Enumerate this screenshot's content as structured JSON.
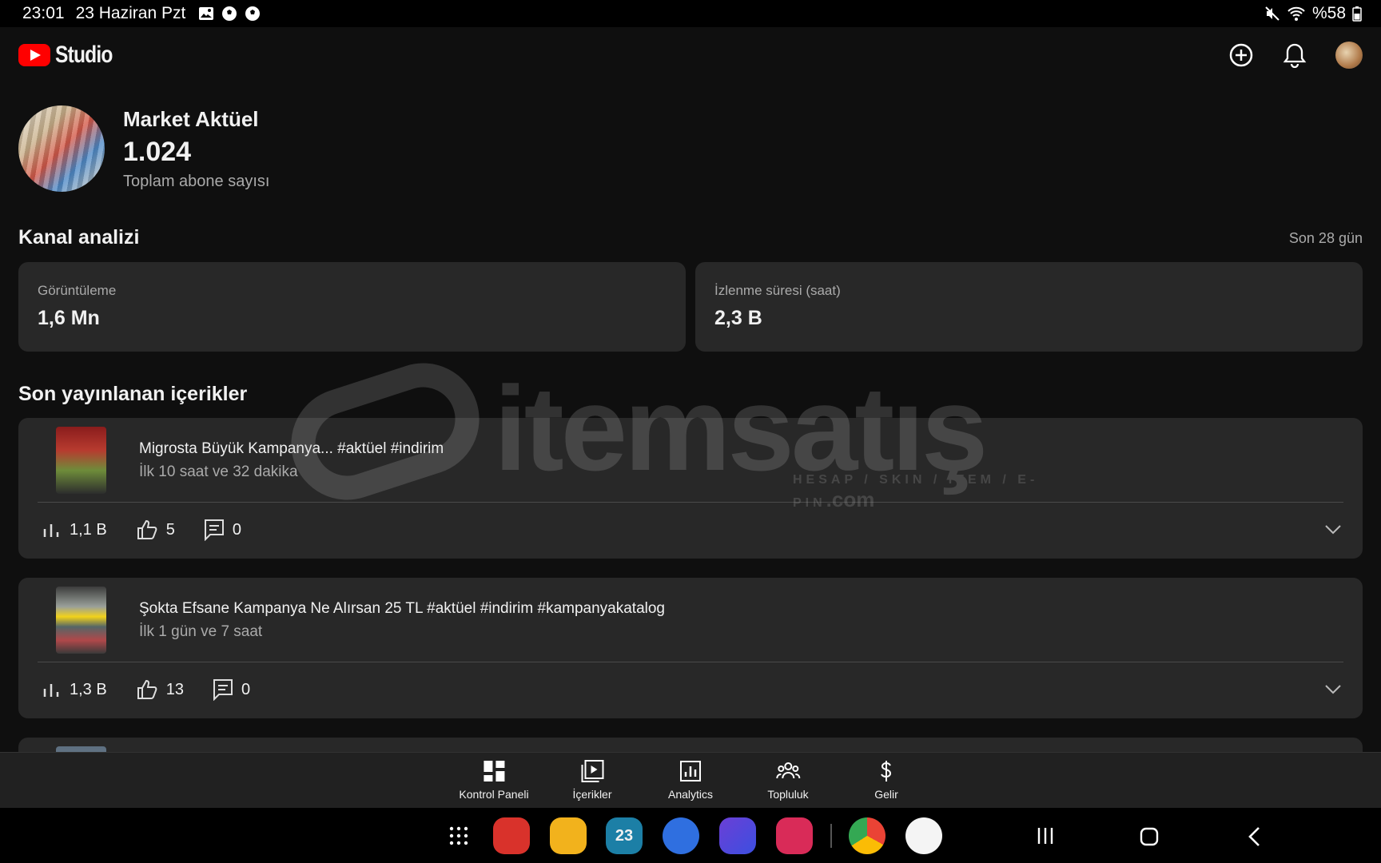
{
  "status_bar": {
    "time": "23:01",
    "date": "23 Haziran Pzt",
    "battery": "%58"
  },
  "app": {
    "logo_text": "Studio"
  },
  "channel": {
    "name": "Market Aktüel",
    "subscriber_count": "1.024",
    "subscriber_label": "Toplam abone sayısı"
  },
  "analytics": {
    "title": "Kanal analizi",
    "period": "Son 28 gün",
    "cards": [
      {
        "label": "Görüntüleme",
        "value": "1,6 Mn"
      },
      {
        "label": "İzlenme süresi (saat)",
        "value": "2,3 B"
      }
    ]
  },
  "recent": {
    "title": "Son yayınlanan içerikler",
    "items": [
      {
        "title": "Migrosta Büyük Kampanya... #aktüel #indirim",
        "subtitle": "İlk 10 saat ve 32 dakika",
        "views": "1,1 B",
        "likes": "5",
        "comments": "0"
      },
      {
        "title": "Şokta Efsane Kampanya Ne Alırsan 25 TL #aktüel #indirim #kampanyakatalog",
        "subtitle": "İlk 1 gün ve 7 saat",
        "views": "1,3 B",
        "likes": "13",
        "comments": "0"
      }
    ]
  },
  "bottom_nav": [
    {
      "label": "Kontrol Paneli",
      "icon": "dashboard-icon"
    },
    {
      "label": "İçerikler",
      "icon": "content-icon"
    },
    {
      "label": "Analytics",
      "icon": "analytics-icon"
    },
    {
      "label": "Topluluk",
      "icon": "community-icon"
    },
    {
      "label": "Gelir",
      "icon": "earn-icon"
    }
  ],
  "watermark": {
    "text": "itemsatış",
    "tagline": "HESAP / SKIN / ITEM / E-PIN",
    "suffix": ".com"
  },
  "dock": {
    "calendar_day": "23"
  },
  "colors": {
    "background": "#0f0f0f",
    "card": "#282828",
    "brand_red": "#ff0000",
    "secondary_text": "#aaaaaa"
  }
}
